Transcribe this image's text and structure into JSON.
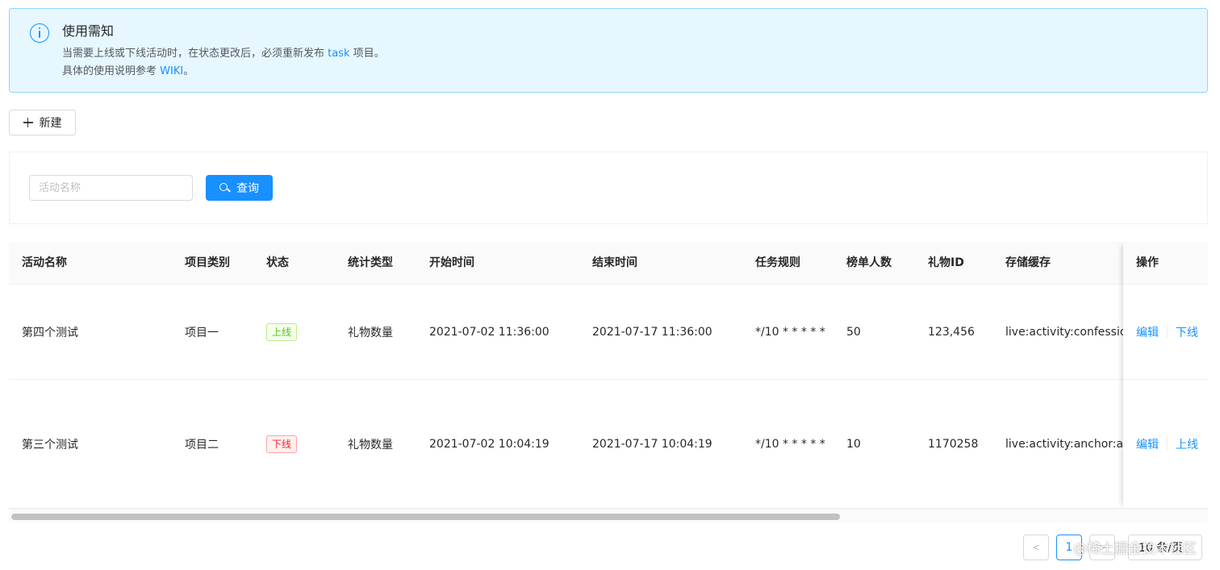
{
  "notice": {
    "title": "使用需知",
    "line1_pre": "当需要上线或下线活动时，在状态更改后，必须重新发布 ",
    "line1_link": "task",
    "line1_post": " 项目。",
    "line2_pre": "具体的使用说明参考 ",
    "line2_link": "WIKI",
    "line2_post": "。",
    "icon": "info-circle-icon"
  },
  "toolbar": {
    "new_label": "新建"
  },
  "search": {
    "placeholder": "活动名称",
    "query_label": "查询"
  },
  "table": {
    "columns": [
      "活动名称",
      "项目类别",
      "状态",
      "统计类型",
      "开始时间",
      "结束时间",
      "任务规则",
      "榜单人数",
      "礼物ID",
      "存储缓存",
      "操作"
    ],
    "rows": [
      {
        "name": "第四个测试",
        "category": "项目一",
        "status": "上线",
        "status_color": "#52c41a",
        "stat_type": "礼物数量",
        "start": "2021-07-02 11:36:00",
        "end": "2021-07-17 11:36:00",
        "rule": "*/10 * * * * *",
        "rank_count": "50",
        "gift_id": "123,456",
        "cache": "live:activity:confession",
        "action_edit": "编辑",
        "action_toggle": "下线"
      },
      {
        "name": "第三个测试",
        "category": "项目二",
        "status": "下线",
        "status_color": "#f5222d",
        "stat_type": "礼物数量",
        "start": "2021-07-02 10:04:19",
        "end": "2021-07-17 10:04:19",
        "rule": "*/10 * * * * *",
        "rank_count": "10",
        "gift_id": "1170258",
        "cache": "live:activity:anchor:alli",
        "action_edit": "编辑",
        "action_toggle": "上线"
      }
    ]
  },
  "pagination": {
    "prev": "<",
    "current": "1",
    "next": ">",
    "page_size": "10 条/页"
  },
  "watermark": "@稀土掘金技术社区",
  "colors": {
    "primary": "#1890ff",
    "notice_bg": "#e6f7ff",
    "notice_border": "#91d5ff"
  }
}
